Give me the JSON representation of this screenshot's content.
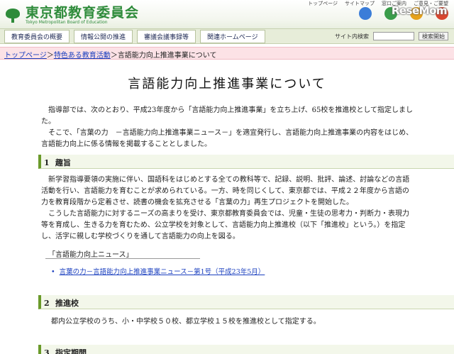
{
  "header": {
    "logo_jp": "東京都教育委員会",
    "logo_en": "Tokyo Metropolitan Board of Education",
    "top_links": [
      "トップページ",
      "サイトマップ",
      "窓口ご案内",
      "ご意見・ご要望"
    ],
    "watermark": "ReseMom"
  },
  "nav": {
    "items": [
      "教育委員会の概要",
      "情報公開の推進",
      "審議会議事録等",
      "関連ホームページ"
    ],
    "search_label": "サイト内検索",
    "search_value": "",
    "search_button": "検索開始"
  },
  "breadcrumb": {
    "home": "トップページ",
    "sep1": "＞",
    "parent": "特色ある教育活動",
    "sep2": "＞",
    "current": "言語能力向上推進事業について"
  },
  "page_title": "言語能力向上推進事業について",
  "intro": {
    "p1": "指導部では、次のとおり、平成23年度から「言語能力向上推進事業」を立ち上げ、65校を推進校として指定しました。",
    "p2": "そこで、「言葉の力　－言語能力向上推進事業ニュース－」を適宜発行し、言語能力向上推進事業の内容をはじめ、言語能力向上に係る情報を掲載することとしました。"
  },
  "sections": [
    {
      "num": "1",
      "title": "趣旨"
    },
    {
      "num": "2",
      "title": "推進校"
    },
    {
      "num": "3",
      "title": "指定期間"
    }
  ],
  "section1": {
    "p1": "新学習指導要領の実施に伴い、国語科をはじめとする全ての教科等で、記録、説明、批評、論述、討論などの言語活動を行い、言語能力を育むことが求められている。一方、時を同じくして、東京都では、平成２２年度から言語の力を教育段階から定着させ、読書の機会を拡充させる「言葉の力」再生プロジェクトを開始した。",
    "p2": "こうした言語能力に対するニーズの高まりを受け、東京都教育委員会では、児童・生徒の思考力・判断力・表現力等を育成し、生きる力を育むため、公立学校を対象として、言語能力向上推進校（以下「推進校」という。）を指定し、活字に親しむ学校づくりを通して言語能力の向上を図る。"
  },
  "news": {
    "label": "「言語能力向上ニュース」",
    "items": [
      "言葉の力－言語能力向上推進事業ニュース－第1号（平成23年5月）"
    ]
  },
  "section2": {
    "text": "都内公立学校のうち、小・中学校５０校、都立学校１５校を推進校として指定する。"
  }
}
